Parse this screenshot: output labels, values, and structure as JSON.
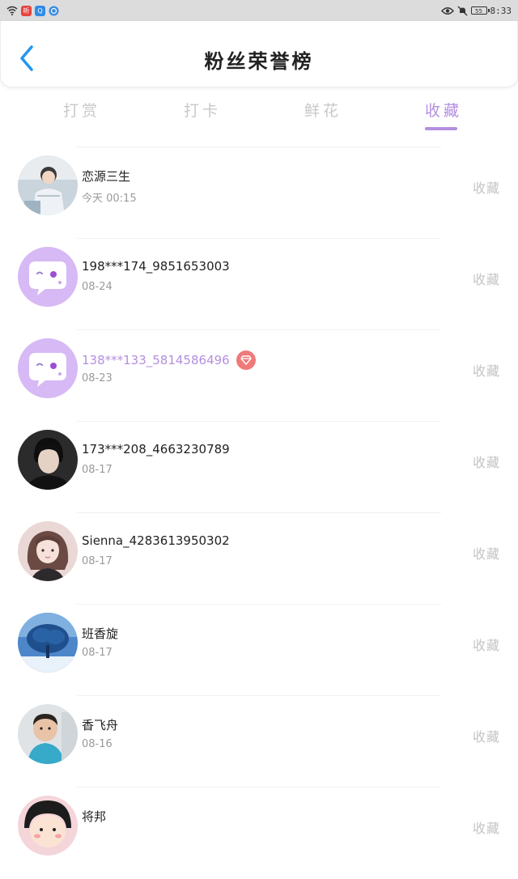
{
  "status_bar": {
    "time": "8:33",
    "battery": "55",
    "app_icon_1": "听",
    "app_icon_2": "Q"
  },
  "header": {
    "title": "粉丝荣誉榜"
  },
  "tabs": [
    {
      "label": "打赏"
    },
    {
      "label": "打卡"
    },
    {
      "label": "鲜花"
    },
    {
      "label": "收藏"
    }
  ],
  "active_tab": "收藏",
  "colors": {
    "accent": "#b48fe0",
    "muted": "#c8c8c8",
    "badge": "#f07a7a",
    "default_avatar": "#d6b9f5"
  },
  "fans": [
    {
      "name": "恋源三生",
      "date": "今天 00:15",
      "action": "收藏",
      "avatar": "photo-person-light"
    },
    {
      "name": "198***174_9851653003",
      "date": "08-24",
      "action": "收藏",
      "avatar": "default-chat-bubble"
    },
    {
      "name": "138***133_5814586496",
      "date": "08-23",
      "action": "收藏",
      "avatar": "default-chat-bubble",
      "vip": true,
      "badge_icon": "diamond-icon"
    },
    {
      "name": "173***208_4663230789",
      "date": "08-17",
      "action": "收藏",
      "avatar": "photo-person-dark"
    },
    {
      "name": "Sienna_4283613950302",
      "date": "08-17",
      "action": "收藏",
      "avatar": "photo-person-pink"
    },
    {
      "name": "班香旋",
      "date": "08-17",
      "action": "收藏",
      "avatar": "photo-tree"
    },
    {
      "name": "香飞舟",
      "date": "08-16",
      "action": "收藏",
      "avatar": "photo-child"
    },
    {
      "name": "将邦",
      "date": "",
      "action": "收藏",
      "avatar": "cartoon-girl"
    }
  ]
}
